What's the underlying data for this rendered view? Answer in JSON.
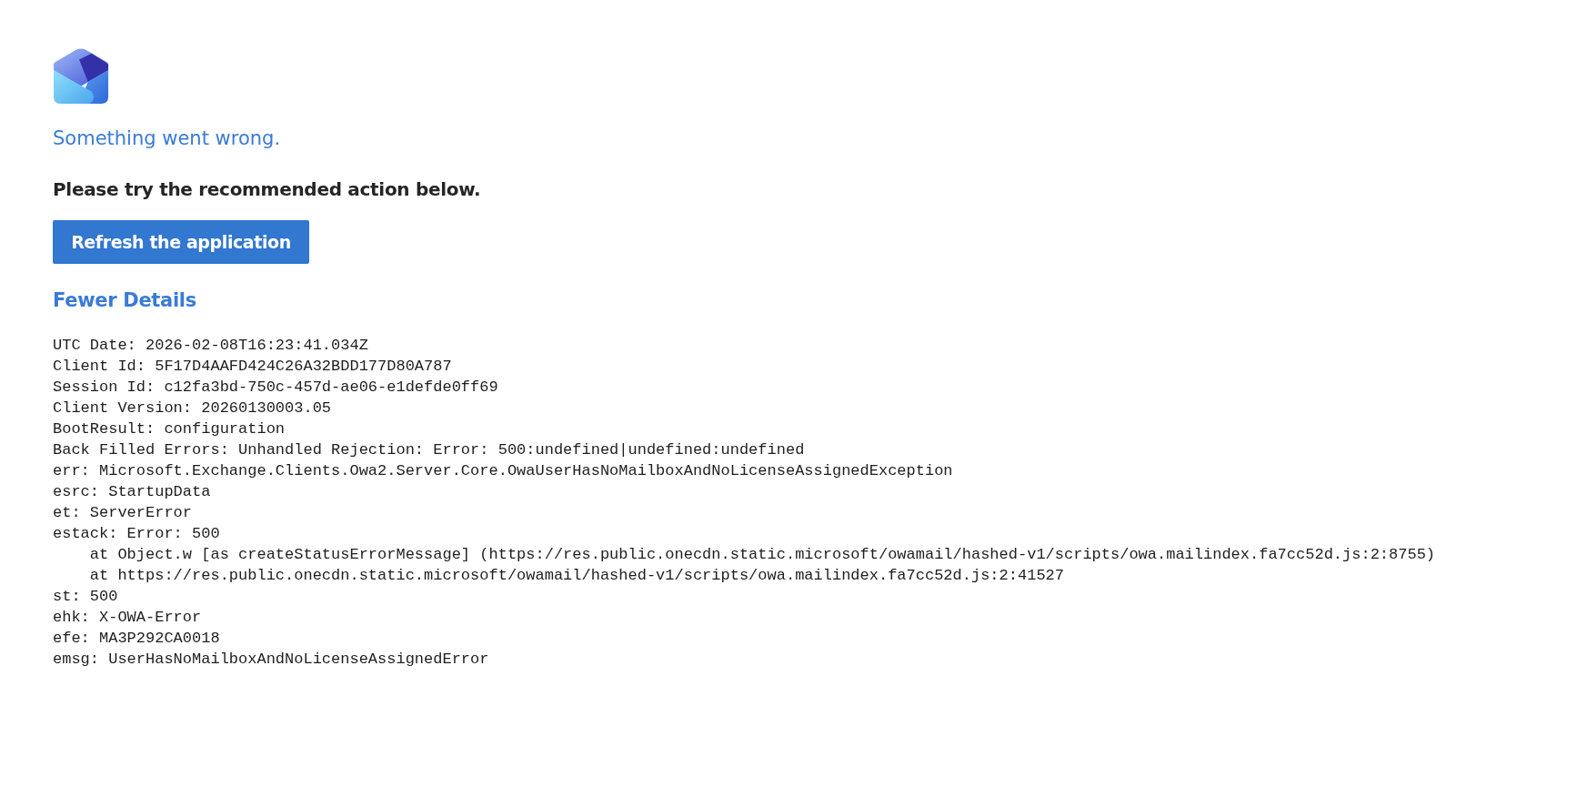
{
  "title": "Something went wrong.",
  "subtitle": "Please try the recommended action below.",
  "action_button": "Refresh the application",
  "details_toggle": "Fewer Details",
  "details_lines": [
    "UTC Date: 2026-02-08T16:23:41.034Z",
    "Client Id: 5F17D4AAFD424C26A32BDD177D80A787",
    "Session Id: c12fa3bd-750c-457d-ae06-e1defde0ff69",
    "Client Version: 20260130003.05",
    "BootResult: configuration",
    "Back Filled Errors: Unhandled Rejection: Error: 500:undefined|undefined:undefined",
    "err: Microsoft.Exchange.Clients.Owa2.Server.Core.OwaUserHasNoMailboxAndNoLicenseAssignedException",
    "esrc: StartupData",
    "et: ServerError",
    "estack: Error: 500",
    "    at Object.w [as createStatusErrorMessage] (https://res.public.onecdn.static.microsoft/owamail/hashed-v1/scripts/owa.mailindex.fa7cc52d.js:2:8755)",
    "    at https://res.public.onecdn.static.microsoft/owamail/hashed-v1/scripts/owa.mailindex.fa7cc52d.js:2:41527",
    "st: 500",
    "ehk: X-OWA-Error",
    "efe: MA3P292CA0018",
    "emsg: UserHasNoMailboxAndNoLicenseAssignedError"
  ]
}
